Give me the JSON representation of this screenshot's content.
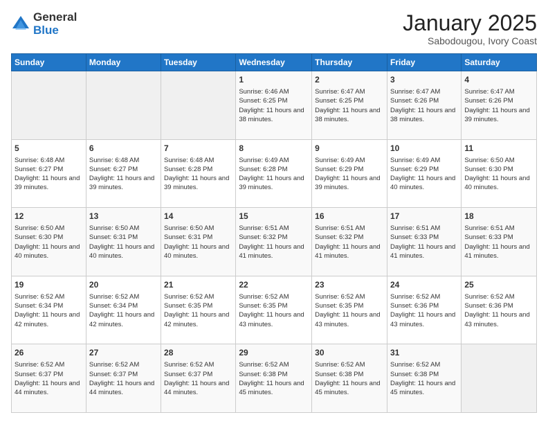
{
  "logo": {
    "general": "General",
    "blue": "Blue"
  },
  "header": {
    "month": "January 2025",
    "location": "Sabodougou, Ivory Coast"
  },
  "weekdays": [
    "Sunday",
    "Monday",
    "Tuesday",
    "Wednesday",
    "Thursday",
    "Friday",
    "Saturday"
  ],
  "weeks": [
    [
      {
        "day": "",
        "info": ""
      },
      {
        "day": "",
        "info": ""
      },
      {
        "day": "",
        "info": ""
      },
      {
        "day": "1",
        "info": "Sunrise: 6:46 AM\nSunset: 6:25 PM\nDaylight: 11 hours and 38 minutes."
      },
      {
        "day": "2",
        "info": "Sunrise: 6:47 AM\nSunset: 6:25 PM\nDaylight: 11 hours and 38 minutes."
      },
      {
        "day": "3",
        "info": "Sunrise: 6:47 AM\nSunset: 6:26 PM\nDaylight: 11 hours and 38 minutes."
      },
      {
        "day": "4",
        "info": "Sunrise: 6:47 AM\nSunset: 6:26 PM\nDaylight: 11 hours and 39 minutes."
      }
    ],
    [
      {
        "day": "5",
        "info": "Sunrise: 6:48 AM\nSunset: 6:27 PM\nDaylight: 11 hours and 39 minutes."
      },
      {
        "day": "6",
        "info": "Sunrise: 6:48 AM\nSunset: 6:27 PM\nDaylight: 11 hours and 39 minutes."
      },
      {
        "day": "7",
        "info": "Sunrise: 6:48 AM\nSunset: 6:28 PM\nDaylight: 11 hours and 39 minutes."
      },
      {
        "day": "8",
        "info": "Sunrise: 6:49 AM\nSunset: 6:28 PM\nDaylight: 11 hours and 39 minutes."
      },
      {
        "day": "9",
        "info": "Sunrise: 6:49 AM\nSunset: 6:29 PM\nDaylight: 11 hours and 39 minutes."
      },
      {
        "day": "10",
        "info": "Sunrise: 6:49 AM\nSunset: 6:29 PM\nDaylight: 11 hours and 40 minutes."
      },
      {
        "day": "11",
        "info": "Sunrise: 6:50 AM\nSunset: 6:30 PM\nDaylight: 11 hours and 40 minutes."
      }
    ],
    [
      {
        "day": "12",
        "info": "Sunrise: 6:50 AM\nSunset: 6:30 PM\nDaylight: 11 hours and 40 minutes."
      },
      {
        "day": "13",
        "info": "Sunrise: 6:50 AM\nSunset: 6:31 PM\nDaylight: 11 hours and 40 minutes."
      },
      {
        "day": "14",
        "info": "Sunrise: 6:50 AM\nSunset: 6:31 PM\nDaylight: 11 hours and 40 minutes."
      },
      {
        "day": "15",
        "info": "Sunrise: 6:51 AM\nSunset: 6:32 PM\nDaylight: 11 hours and 41 minutes."
      },
      {
        "day": "16",
        "info": "Sunrise: 6:51 AM\nSunset: 6:32 PM\nDaylight: 11 hours and 41 minutes."
      },
      {
        "day": "17",
        "info": "Sunrise: 6:51 AM\nSunset: 6:33 PM\nDaylight: 11 hours and 41 minutes."
      },
      {
        "day": "18",
        "info": "Sunrise: 6:51 AM\nSunset: 6:33 PM\nDaylight: 11 hours and 41 minutes."
      }
    ],
    [
      {
        "day": "19",
        "info": "Sunrise: 6:52 AM\nSunset: 6:34 PM\nDaylight: 11 hours and 42 minutes."
      },
      {
        "day": "20",
        "info": "Sunrise: 6:52 AM\nSunset: 6:34 PM\nDaylight: 11 hours and 42 minutes."
      },
      {
        "day": "21",
        "info": "Sunrise: 6:52 AM\nSunset: 6:35 PM\nDaylight: 11 hours and 42 minutes."
      },
      {
        "day": "22",
        "info": "Sunrise: 6:52 AM\nSunset: 6:35 PM\nDaylight: 11 hours and 43 minutes."
      },
      {
        "day": "23",
        "info": "Sunrise: 6:52 AM\nSunset: 6:35 PM\nDaylight: 11 hours and 43 minutes."
      },
      {
        "day": "24",
        "info": "Sunrise: 6:52 AM\nSunset: 6:36 PM\nDaylight: 11 hours and 43 minutes."
      },
      {
        "day": "25",
        "info": "Sunrise: 6:52 AM\nSunset: 6:36 PM\nDaylight: 11 hours and 43 minutes."
      }
    ],
    [
      {
        "day": "26",
        "info": "Sunrise: 6:52 AM\nSunset: 6:37 PM\nDaylight: 11 hours and 44 minutes."
      },
      {
        "day": "27",
        "info": "Sunrise: 6:52 AM\nSunset: 6:37 PM\nDaylight: 11 hours and 44 minutes."
      },
      {
        "day": "28",
        "info": "Sunrise: 6:52 AM\nSunset: 6:37 PM\nDaylight: 11 hours and 44 minutes."
      },
      {
        "day": "29",
        "info": "Sunrise: 6:52 AM\nSunset: 6:38 PM\nDaylight: 11 hours and 45 minutes."
      },
      {
        "day": "30",
        "info": "Sunrise: 6:52 AM\nSunset: 6:38 PM\nDaylight: 11 hours and 45 minutes."
      },
      {
        "day": "31",
        "info": "Sunrise: 6:52 AM\nSunset: 6:38 PM\nDaylight: 11 hours and 45 minutes."
      },
      {
        "day": "",
        "info": ""
      }
    ]
  ]
}
